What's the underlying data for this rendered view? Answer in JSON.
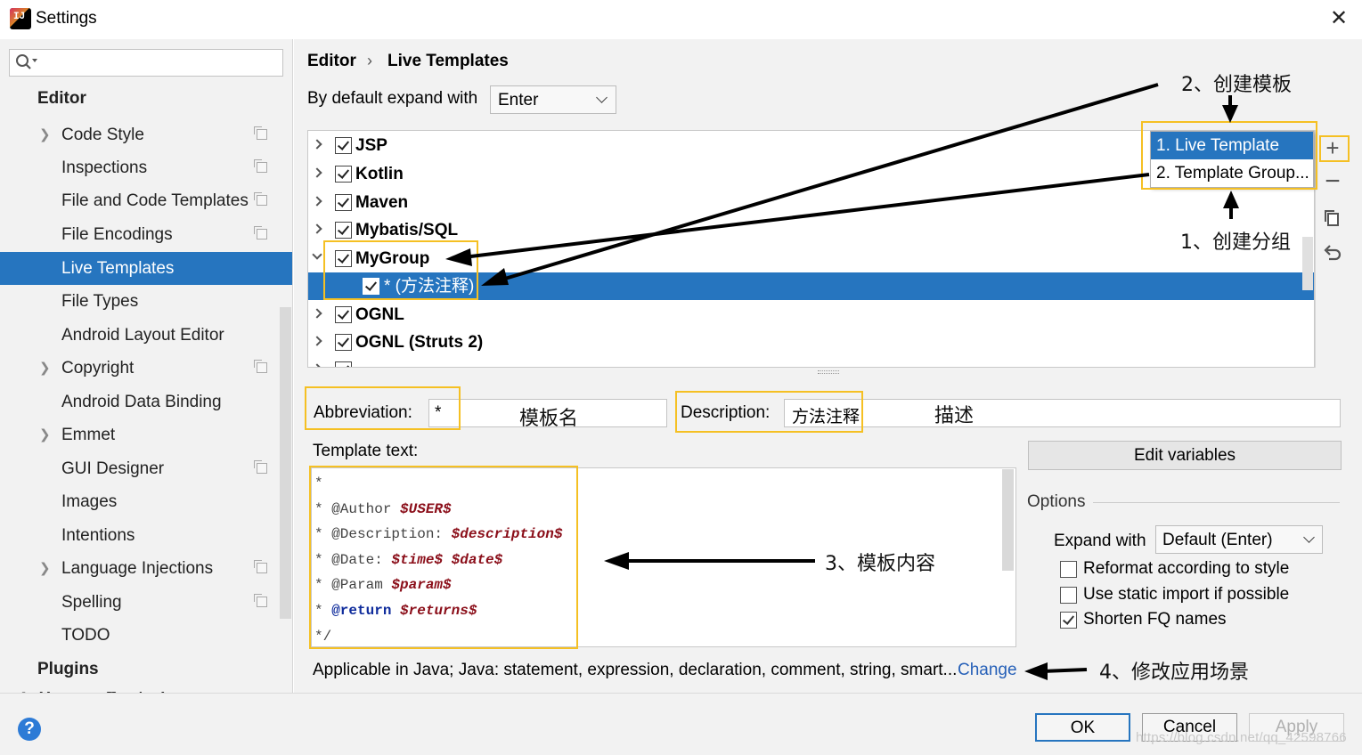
{
  "window": {
    "title": "Settings",
    "logo_text": "IJ"
  },
  "search": {
    "placeholder": ""
  },
  "sidebar": {
    "header": "Editor",
    "items": [
      {
        "label": "Code Style",
        "arrow": true,
        "cfg": true
      },
      {
        "label": "Inspections",
        "arrow": false,
        "cfg": true
      },
      {
        "label": "File and Code Templates",
        "arrow": false,
        "cfg": true
      },
      {
        "label": "File Encodings",
        "arrow": false,
        "cfg": true
      },
      {
        "label": "Live Templates",
        "arrow": false,
        "cfg": false,
        "selected": true
      },
      {
        "label": "File Types",
        "arrow": false,
        "cfg": false
      },
      {
        "label": "Android Layout Editor",
        "arrow": false,
        "cfg": false
      },
      {
        "label": "Copyright",
        "arrow": true,
        "cfg": true
      },
      {
        "label": "Android Data Binding",
        "arrow": false,
        "cfg": false
      },
      {
        "label": "Emmet",
        "arrow": true,
        "cfg": false
      },
      {
        "label": "GUI Designer",
        "arrow": false,
        "cfg": true
      },
      {
        "label": "Images",
        "arrow": false,
        "cfg": false
      },
      {
        "label": "Intentions",
        "arrow": false,
        "cfg": false
      },
      {
        "label": "Language Injections",
        "arrow": true,
        "cfg": true
      },
      {
        "label": "Spelling",
        "arrow": false,
        "cfg": true
      },
      {
        "label": "TODO",
        "arrow": false,
        "cfg": false
      }
    ],
    "plugins": "Plugins",
    "partial": "Version Control"
  },
  "breadcrumb": {
    "first": "Editor",
    "sep": "›",
    "second": "Live Templates"
  },
  "expand_default": {
    "label": "By default expand with",
    "value": "Enter"
  },
  "tree": [
    {
      "label": "JSP",
      "expanded": false
    },
    {
      "label": "Kotlin",
      "expanded": false
    },
    {
      "label": "Maven",
      "expanded": false
    },
    {
      "label": "Mybatis/SQL",
      "expanded": false
    },
    {
      "label": "MyGroup",
      "expanded": true
    },
    {
      "label": "* (方法注释)",
      "child": true,
      "selected": true
    },
    {
      "label": "OGNL",
      "expanded": false
    },
    {
      "label": "OGNL (Struts 2)",
      "expanded": false
    }
  ],
  "popup": {
    "item1": "1. Live Template",
    "item2": "2. Template Group..."
  },
  "toolbar": {
    "add": "+",
    "remove": "−",
    "copy": "copy-icon",
    "restore": "restore-icon"
  },
  "abbreviation": {
    "label": "Abbreviation:",
    "value": "*"
  },
  "description": {
    "label": "Description:",
    "value": "方法注释"
  },
  "template_text": {
    "label": "Template text:",
    "lines": [
      [
        {
          "t": "*",
          "c": ""
        }
      ],
      [
        {
          "t": "* @Author ",
          "c": ""
        },
        {
          "t": "$USER$",
          "c": "v"
        }
      ],
      [
        {
          "t": "* @Description: ",
          "c": ""
        },
        {
          "t": "$description$",
          "c": "v"
        }
      ],
      [
        {
          "t": "* @Date: ",
          "c": ""
        },
        {
          "t": "$time$",
          "c": "v"
        },
        {
          "t": " ",
          "c": ""
        },
        {
          "t": "$date$",
          "c": "v"
        }
      ],
      [
        {
          "t": "* @Param ",
          "c": ""
        },
        {
          "t": "$param$",
          "c": "v"
        }
      ],
      [
        {
          "t": "* ",
          "c": ""
        },
        {
          "t": "@return",
          "c": "kw"
        },
        {
          "t": " ",
          "c": ""
        },
        {
          "t": "$returns$",
          "c": "v"
        }
      ],
      [
        {
          "t": "*/",
          "c": ""
        }
      ]
    ]
  },
  "edit_variables": "Edit variables",
  "options": {
    "title": "Options",
    "expand_with_label": "Expand with",
    "expand_with_value": "Default (Enter)",
    "checks": [
      {
        "label": "Reformat according to style",
        "checked": false
      },
      {
        "label": "Use static import if possible",
        "checked": false
      },
      {
        "label": "Shorten FQ names",
        "checked": true
      }
    ]
  },
  "applicable": {
    "text": "Applicable in Java; Java: statement, expression, declaration, comment, string, smart...",
    "link": "Change"
  },
  "footer": {
    "help": "?",
    "ok": "OK",
    "cancel": "Cancel",
    "apply": "Apply"
  },
  "watermark": "https://blog.csdn.net/qq_42598766",
  "annotations": {
    "create_template": "2、创建模板",
    "create_group": "1、创建分组",
    "template_name": "模板名",
    "description": "描述",
    "template_content": "3、模板内容",
    "modify_scope": "4、修改应用场景"
  },
  "colors": {
    "selection": "#2675bf",
    "highlight": "#f5c023",
    "variable": "#8b0f1a",
    "link": "#2660b8"
  }
}
